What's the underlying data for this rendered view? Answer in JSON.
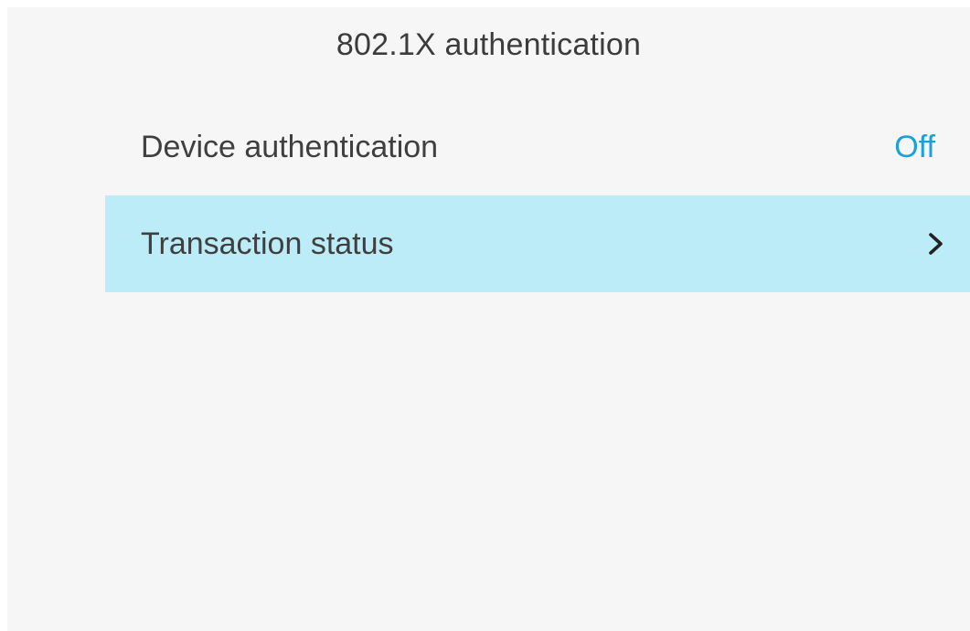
{
  "header": {
    "title": "802.1X authentication"
  },
  "menu": {
    "items": [
      {
        "label": "Device authentication",
        "value": "Off"
      },
      {
        "label": "Transaction status"
      }
    ]
  },
  "colors": {
    "background": "#f6f6f6",
    "selected_row": "#bcecf8",
    "value_accent": "#1aa1d8",
    "text": "#3f3f3f"
  },
  "icons": {
    "transaction_status_indicator": "chevron-right-icon"
  }
}
